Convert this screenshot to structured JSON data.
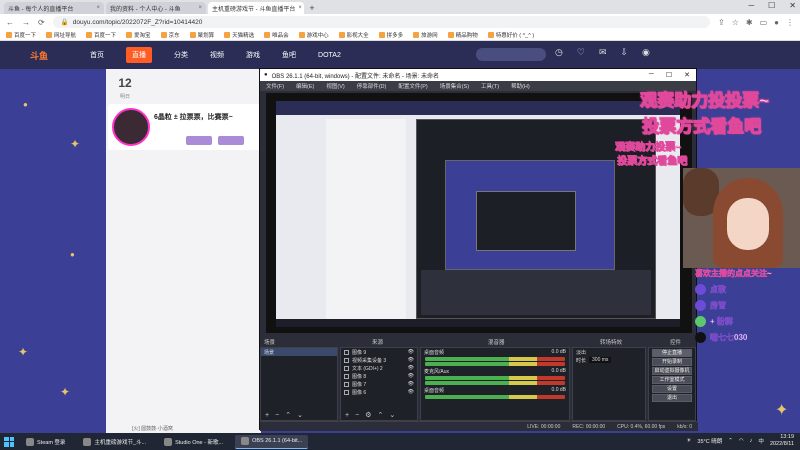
{
  "browser": {
    "tabs": [
      {
        "label": "斗鱼 - 每个人的直播平台",
        "active": false
      },
      {
        "label": "我的资料 - 个人中心 - 斗鱼",
        "active": false
      },
      {
        "label": "主机重磅游戏节 - 斗鱼直播平台",
        "active": true
      }
    ],
    "new_tab": "+",
    "url": "douyu.com/topic/2022072F_Z?rid=10414420",
    "bookmarks": [
      "百度一下",
      "网址导航",
      "百度一下",
      "爱淘宝",
      "京东",
      "聚划算",
      "天猫精选",
      "唯品会",
      "游戏中心",
      "影视大全",
      "拼多多",
      "旅游网",
      "精品购物",
      "特惠好价 ( ^_^ )"
    ]
  },
  "site": {
    "logo": "斗鱼",
    "nav": [
      "首页",
      "直播",
      "分类",
      "视频",
      "游戏",
      "鱼吧",
      "DOTA2"
    ],
    "active_nav": "直播",
    "date_num": "12",
    "date_sub": "明日",
    "card_title": "6晶粒 ± 拉票票，比赛票~",
    "bottom_text": "[火] 圆鼓鼓·小酒窝"
  },
  "obs": {
    "title": "OBS 26.1.1 (64-bit, windows) - 配置文件: 未命名 - 场景: 未命名",
    "menu": [
      "文件(F)",
      "编辑(E)",
      "视图(V)",
      "停靠部件(D)",
      "配置文件(P)",
      "场景集合(S)",
      "工具(T)",
      "帮助(H)"
    ],
    "docks": {
      "scenes_header": "场景",
      "sources_header": "来源",
      "mixer_header": "混音器",
      "transitions_header": "转场特效",
      "controls_header": "控件",
      "scene_item": "场景",
      "sources": [
        "图像 9",
        "视频采集设备 3",
        "文本 (GDI+) 2",
        "图像 8",
        "图像 7",
        "图像 6"
      ],
      "mixer": [
        "桌面音频",
        "麦克风/Aux",
        "桌面音频"
      ],
      "mixer_db": [
        "0.0 dB",
        "0.0 dB",
        "0.0 dB"
      ],
      "transition": "淡出",
      "duration_label": "时长",
      "duration": "300 ms",
      "controls": [
        "停止直播",
        "开始录制",
        "启动虚拟摄像机",
        "工作室模式",
        "设置",
        "退出"
      ]
    },
    "status": {
      "live": "LIVE: 00:00:00",
      "rec": "REC: 00:00:00",
      "cpu": "CPU: 0.4%, 60.00 fps",
      "kbps": "kb/s: 0"
    }
  },
  "overlay": {
    "line1": "观赛助力投投票~",
    "line2": "投票方式看鱼吧",
    "small1": "观赛助力投票~",
    "small2": "投票方式看鱼吧",
    "follow_title": "喜欢主播的点点关注~",
    "follow_rows": [
      "点歌",
      "房管",
      "+ 粉群",
      "噫七七030"
    ]
  },
  "taskbar": {
    "tasks": [
      {
        "label": "Steam 登录",
        "active": false
      },
      {
        "label": "主机重磅游戏节_斗...",
        "active": false
      },
      {
        "label": "Studio One - 新歌...",
        "active": false
      },
      {
        "label": "OBS 26.1.1 (64-bit...",
        "active": true
      }
    ],
    "weather": "35°C 晴朗",
    "lang": "中",
    "time": "13:19",
    "date": "2022/8/11"
  }
}
